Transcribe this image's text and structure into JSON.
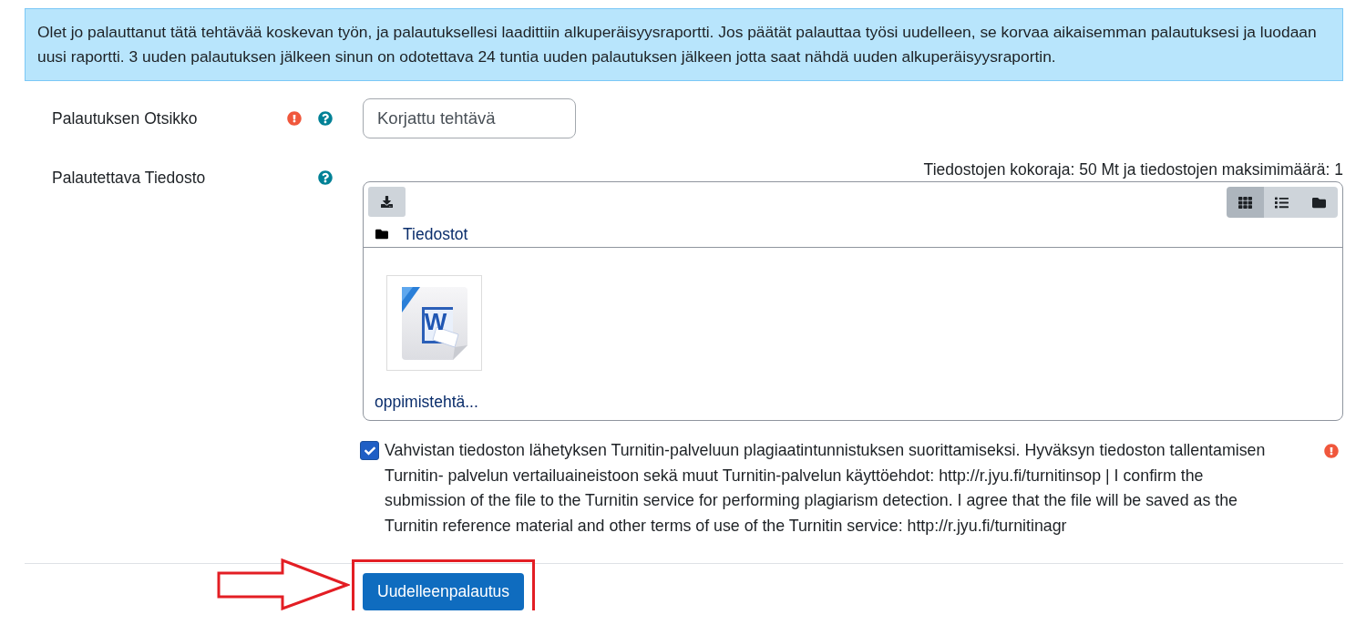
{
  "notice": {
    "text": "Olet jo palauttanut tätä tehtävää koskevan työn, ja palautuksellesi laadittiin alkuperäisyysraportti. Jos päätät palauttaa työsi uudelleen, se korvaa aikaisemman palautuksesi ja luodaan uusi raportti. 3 uuden palautuksen jälkeen sinun on odotettava 24 tuntia uuden palautuksen jälkeen jotta saat nähdä uuden alkuperäisyysraportin."
  },
  "fields": [
    {
      "kind": "text",
      "label": "Palautuksen Otsikko",
      "required": true,
      "help": true,
      "value": "Korjattu tehtävä"
    },
    {
      "kind": "filemanager",
      "label": "Palautettava Tiedosto",
      "required": false,
      "help": true,
      "limits": "Tiedostojen kokoraja: 50 Mt ja tiedostojen maksimimäärä: 1",
      "view_modes": [
        {
          "kind": "icons",
          "selected": true
        },
        {
          "kind": "list",
          "selected": false
        },
        {
          "kind": "tree",
          "selected": false
        }
      ],
      "path": "Tiedostot",
      "files": [
        {
          "name": "oppimistehtä...",
          "kind": "word",
          "icon_text": "W"
        }
      ]
    }
  ],
  "agreement": {
    "checked": true,
    "required": true,
    "text": "Vahvistan tiedoston lähetyksen Turnitin-palveluun plagiaatintunnistuksen suorittamiseksi. Hyväksyn tiedoston tallentamisen Turnitin- palvelun vertailuaineistoon sekä muut Turnitin-palvelun käyttöehdot: http://r.jyu.fi/turnitinsop | I confirm the submission of the file to the Turnitin service for performing plagiarism detection. I agree that the file will be saved as the Turnitin reference material and other terms of use of the Turnitin service: http://r.jyu.fi/turnitinagr"
  },
  "submit": {
    "label": "Uudelleenpalautus",
    "highlighted": true
  }
}
